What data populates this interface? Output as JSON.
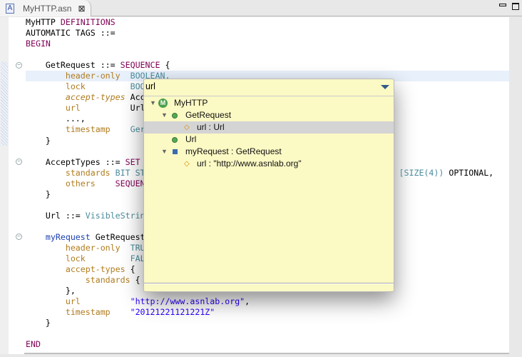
{
  "tab": {
    "title": "MyHTTP.asn",
    "icon": "asn-file-icon",
    "close": "⊠"
  },
  "code": {
    "l1a": "MyHTTP",
    "l1b": "DEFINITIONS",
    "l2": "AUTOMATIC TAGS ::=",
    "l3": "BEGIN",
    "l5a": "GetRequest ::=",
    "l5b": "SEQUENCE",
    "l5c": "{",
    "l6a": "header-only",
    "l6b": "BOOLEAN,",
    "l7a": "lock",
    "l7b": "BOO",
    "l8a": "accept-types",
    "l8b": "Acc",
    "l9a": "url",
    "l9b": "Url",
    "l10": "...,",
    "l11a": "timestamp",
    "l11b": "Ger",
    "l12": "}",
    "l14a": "AcceptTypes ::=",
    "l14b": "SET",
    "l15a": "standards",
    "l15b": "BIT ST",
    "l15c": "[SIZE(4))",
    "l15d": "OPTIONAL,",
    "l16a": "others",
    "l16b": "SEQUEN",
    "l17": "}",
    "l19a": "Url ::=",
    "l19b": "VisibleStrin",
    "l21a": "myRequest",
    "l21b": "GetRequest",
    "l22a": "header-only",
    "l22b": "TRU",
    "l23a": "lock",
    "l23b": "FAL",
    "l24a": "accept-types",
    "l24b": "{",
    "l25a": "standards",
    "l25b": "{",
    "l26": "},",
    "l27a": "url",
    "l27b": "\"http://www.asnlab.org\"",
    "l27c": ",",
    "l28a": "timestamp",
    "l28b": "\"20121221121221Z\"",
    "l29": "}",
    "l31": "END"
  },
  "quick_outline": {
    "filter_value": "url",
    "items": [
      {
        "label": "MyHTTP",
        "icon": "module-icon",
        "expanded": true
      },
      {
        "label": "GetRequest",
        "icon": "type-icon",
        "expanded": true
      },
      {
        "label": "url : Url",
        "icon": "field-icon",
        "selected": true
      },
      {
        "label": "Url",
        "icon": "type-icon"
      },
      {
        "label": "myRequest : GetRequest",
        "icon": "value-icon",
        "expanded": true
      },
      {
        "label": "url : \"http://www.asnlab.org\"",
        "icon": "field-icon"
      }
    ]
  }
}
